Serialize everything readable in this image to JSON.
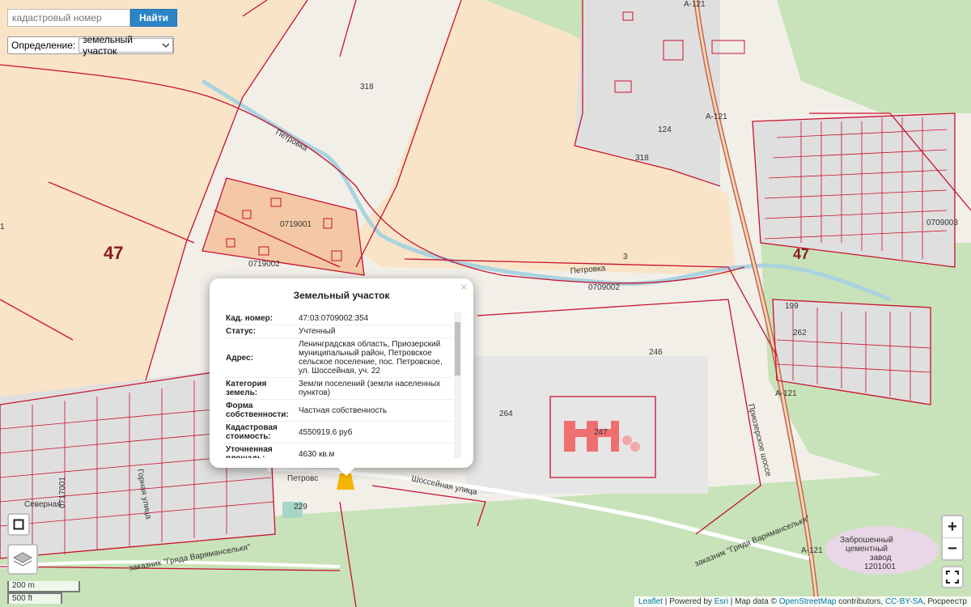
{
  "search": {
    "placeholder": "кадастровый номер",
    "button_label": "Найти"
  },
  "definition": {
    "label": "Определение:",
    "value": "земельный участок"
  },
  "popup": {
    "title": "Земельный участок",
    "close": "×",
    "rows": [
      {
        "key": "Кад. номер:",
        "value": "47:03:0709002:354"
      },
      {
        "key": "Статус:",
        "value": "Учтенный"
      },
      {
        "key": "Адрес:",
        "value": "Ленинградская область, Приозерский муниципальный район, Петровское сельское поселение, пос. Петровское, ул. Шоссейная, уч. 22"
      },
      {
        "key": "Категория земель:",
        "value": "Земли поселений (земли населенных пунктов)"
      },
      {
        "key": "Форма собственности:",
        "value": "Частная собственность"
      },
      {
        "key": "Кадастровая стоимость:",
        "value": "4550919.6 руб"
      },
      {
        "key": "Уточненная площадь:",
        "value": "4630 кв.м"
      }
    ]
  },
  "map": {
    "labels": {
      "q47_left": "47",
      "q47_right": "47",
      "n318_top": "318",
      "n318_right": "318",
      "n0719001": "0719001",
      "n0719002": "0719002",
      "n0709002": "0709002",
      "n0709003": "0709003",
      "n0717001": "0717001",
      "n1201001": "1201001",
      "n3": "3",
      "n246": "246",
      "n264": "264",
      "n247": "247",
      "n262": "262",
      "n199": "199",
      "n124": "124",
      "n229": "229",
      "n1": "1",
      "a121_top": "А-121",
      "a121_mid": "А-121",
      "a121_low": "А-121",
      "a121_bottom": "А-121",
      "petrovka_1": "Петровка",
      "petrovka_2": "Петровка",
      "shosseinaya": "Шоссейная улица",
      "priozerskoe": "Приозерское шоссе",
      "petrovskoe": "Петровс",
      "zakaznik_left": "заказник \"Гряда Варяманселькя\"",
      "zakaznik_right": "заказник \"Гряда Варяманселькя\"",
      "cement_1": "Заброшенный",
      "cement_2": "цементный",
      "cement_3": "завод",
      "severnaya": "Северная",
      "gorkaya": "Горная улица"
    },
    "colors": {
      "parcel_stroke": "#c8102e",
      "forest": "#c8e3b9",
      "field": "#f9e4c8",
      "residential": "#e0dfdf",
      "water": "#aad3df"
    }
  },
  "controls": {
    "zoom_in": "+",
    "zoom_out": "−",
    "layers_icon": "layers-icon",
    "fullscreen_icon": "fullscreen-icon",
    "draw_icon": "square-icon"
  },
  "scale": {
    "metric": "200 m",
    "imperial": "500 ft"
  },
  "attribution": {
    "leaflet": "Leaflet",
    "sep1": " | Powered by ",
    "esri": "Esri",
    "sep2": " | Map data © ",
    "osm": "OpenStreetMap",
    "sep3": " contributors, ",
    "ccbysa": "CC-BY-SA",
    "sep4": ", Росреестр"
  }
}
